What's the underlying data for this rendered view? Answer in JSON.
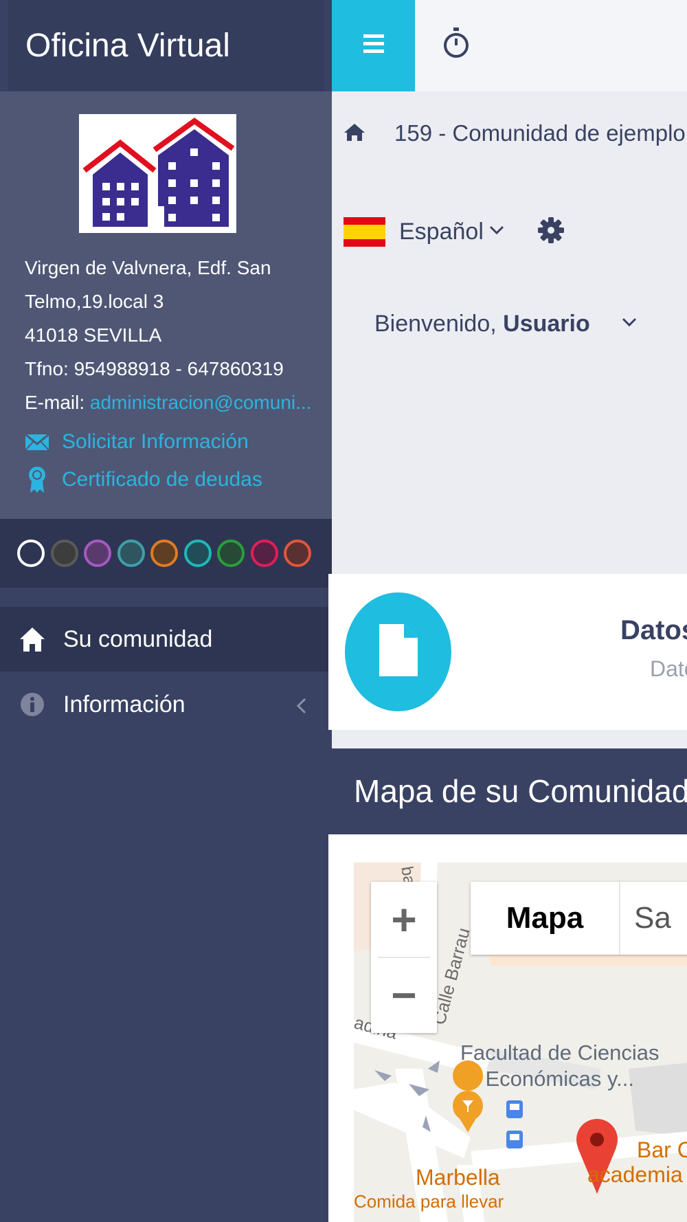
{
  "sidebar": {
    "brand": "Oficina Virtual",
    "address_line1": "Virgen de Valvnera, Edf. San",
    "address_line2": "Telmo,19.local 3",
    "address_line3": "41018 SEVILLA",
    "phone": "Tfno: 954988918 - 647860319",
    "email_label": "E-mail:",
    "email": "administracion@comuni...",
    "link_info": "Solicitar Información",
    "link_cert": "Certificado de deudas",
    "swatch_colors": [
      "#ffffff",
      "#5a5a5a",
      "#a45ac0",
      "#3f9fa8",
      "#e07b22",
      "#1fb8b8",
      "#2c9c3f",
      "#e01e5a",
      "#e0573a"
    ],
    "nav": [
      {
        "label": "Su comunidad"
      },
      {
        "label": "Información"
      }
    ]
  },
  "header": {
    "breadcrumb": "159 - Comunidad de ejemplo",
    "language": "Español",
    "welcome_prefix": "Bienvenido,",
    "welcome_user": "Usuario"
  },
  "card": {
    "title": "Datos",
    "subtitle": "Dato"
  },
  "map": {
    "section_title": "Mapa de su Comunidad",
    "zoom_in": "+",
    "zoom_out": "−",
    "type_map": "Mapa",
    "type_satellite": "Sa",
    "label_facultad_1": "Facultad de Ciencias",
    "label_facultad_2": "Económicas y...",
    "label_marbella": "Marbella",
    "label_comida": "Comida para llevar",
    "label_bar_1": "Bar C",
    "label_bar_2": "academia",
    "street_1": "Calle Barrau",
    "street_2": "ba",
    "street_3": "adina"
  },
  "colors": {
    "accent": "#1fbde0",
    "sidebar": "#394263",
    "link": "#2bb4df"
  }
}
